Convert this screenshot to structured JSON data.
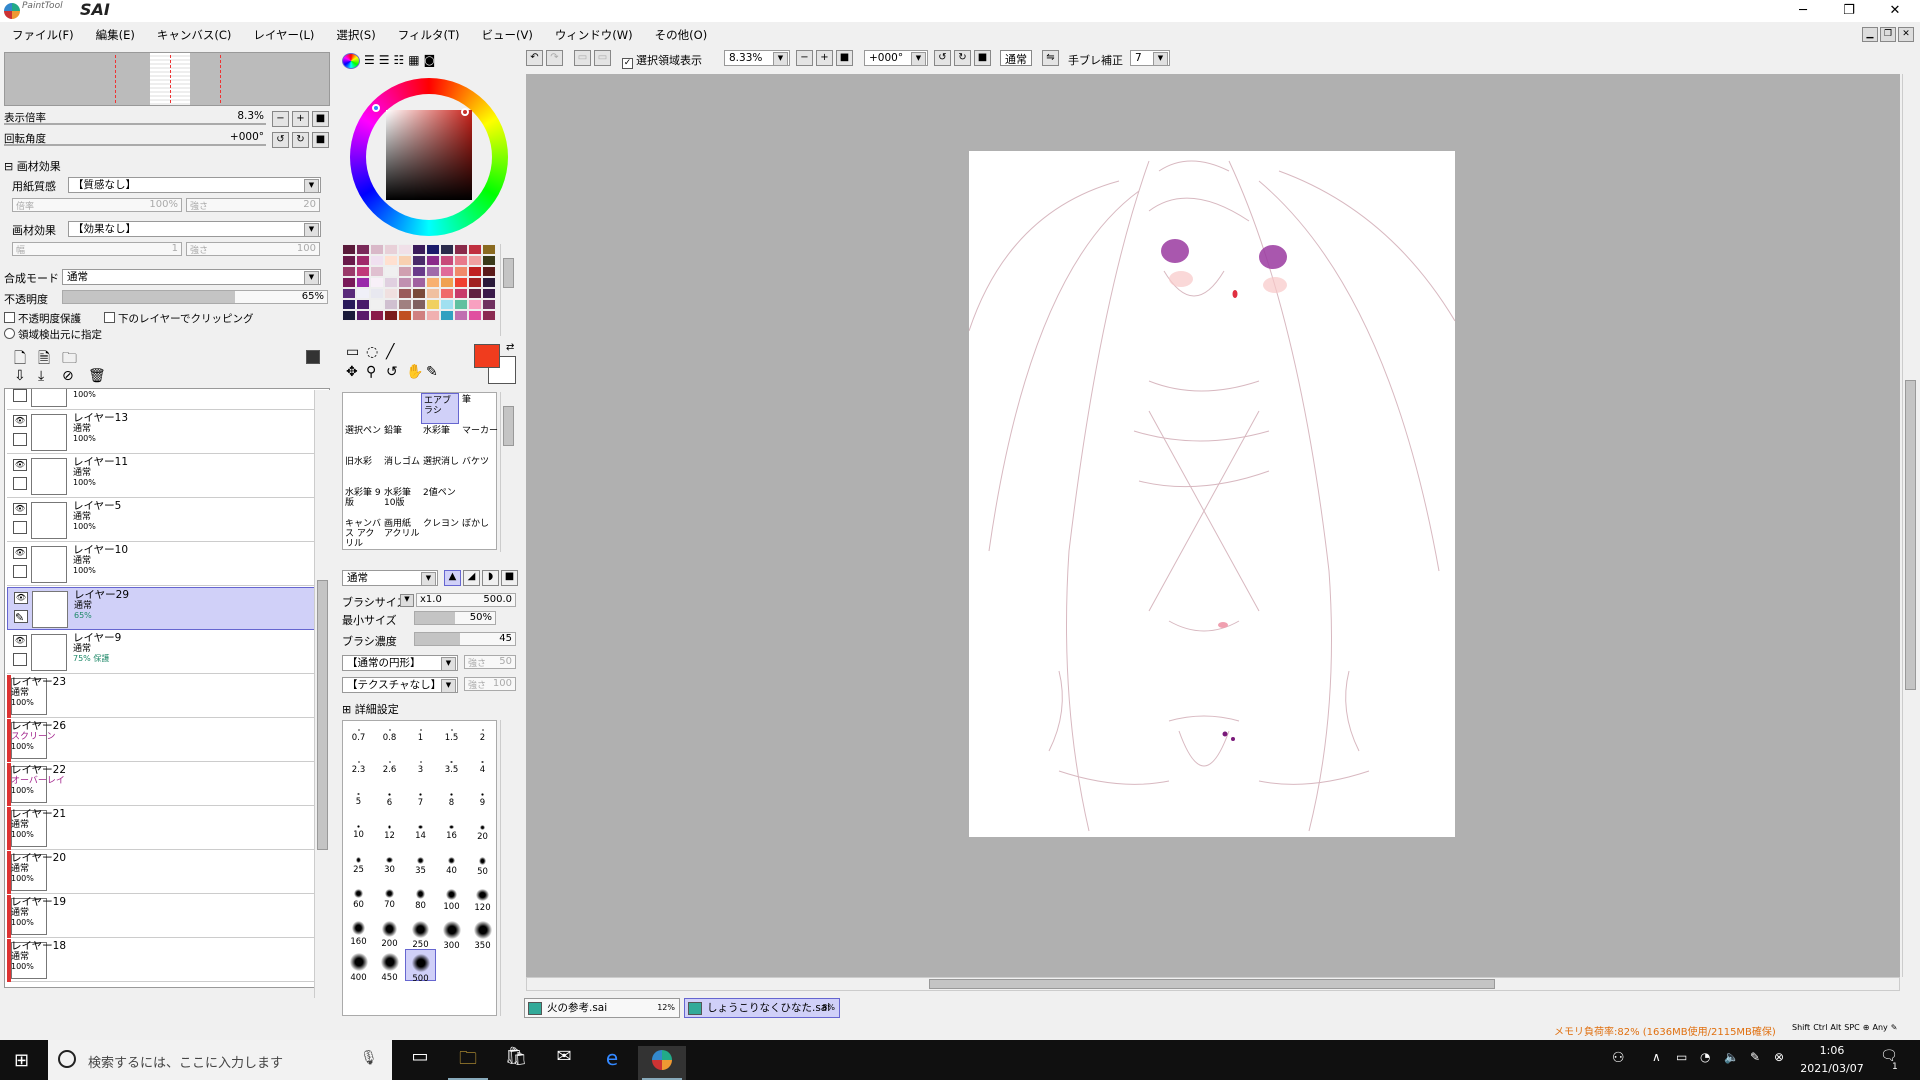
{
  "app": {
    "logo_small": "PaintTool",
    "logo_big": "SAI"
  },
  "window_controls": {
    "minimize": "─",
    "restore": "❐",
    "close": "✕"
  },
  "menu": [
    "ファイル(F)",
    "編集(E)",
    "キャンバス(C)",
    "レイヤー(L)",
    "選択(S)",
    "フィルタ(T)",
    "ビュー(V)",
    "ウィンドウ(W)",
    "その他(O)"
  ],
  "navigator": {
    "zoom_label": "表示倍率",
    "zoom_value": "8.3%",
    "rotation_label": "回転角度",
    "rotation_value": "+000°"
  },
  "material_effects": {
    "header": "画材効果",
    "paper_label": "用紙質感",
    "paper_value": "【質感なし】",
    "scale_label": "倍率",
    "scale_value": "100%",
    "strength_label": "強さ",
    "strength_value": "20",
    "effect_label": "画材効果",
    "effect_value": "【効果なし】",
    "width_label": "幅",
    "width_value": "1",
    "strength2_label": "強さ",
    "strength2_value": "100"
  },
  "layer_props": {
    "blend_label": "合成モード",
    "blend_value": "通常",
    "opacity_label": "不透明度",
    "opacity_value": "65%",
    "opacity_fraction": 0.65,
    "protect_label": "不透明度保護",
    "clip_label": "下のレイヤーでクリッピング",
    "selection_source_label": "領域検出元に指定"
  },
  "layers": [
    {
      "name": "",
      "mode": "通常",
      "opacity": "100%",
      "red": false,
      "selected": false
    },
    {
      "name": "レイヤー13",
      "mode": "通常",
      "opacity": "100%",
      "red": false,
      "selected": false
    },
    {
      "name": "レイヤー11",
      "mode": "通常",
      "opacity": "100%",
      "red": false,
      "selected": false
    },
    {
      "name": "レイヤー5",
      "mode": "通常",
      "opacity": "100%",
      "red": false,
      "selected": false
    },
    {
      "name": "レイヤー10",
      "mode": "通常",
      "opacity": "100%",
      "red": false,
      "selected": false
    },
    {
      "name": "レイヤー29",
      "mode": "通常",
      "opacity": "65%",
      "red": false,
      "selected": true
    },
    {
      "name": "レイヤー9",
      "mode": "通常",
      "opacity": "75%  保護",
      "red": false,
      "selected": false
    },
    {
      "name": "レイヤー23",
      "mode": "通常",
      "opacity": "100%",
      "red": true,
      "selected": false
    },
    {
      "name": "レイヤー26",
      "mode": "スクリーン",
      "opacity": "100%",
      "red": true,
      "selected": false
    },
    {
      "name": "レイヤー22",
      "mode": "オーバーレイ",
      "opacity": "100%",
      "red": true,
      "selected": false
    },
    {
      "name": "レイヤー21",
      "mode": "通常",
      "opacity": "100%",
      "red": true,
      "selected": false
    },
    {
      "name": "レイヤー20",
      "mode": "通常",
      "opacity": "100%",
      "red": true,
      "selected": false
    },
    {
      "name": "レイヤー19",
      "mode": "通常",
      "opacity": "100%",
      "red": true,
      "selected": false
    },
    {
      "name": "レイヤー18",
      "mode": "通常",
      "opacity": "100%",
      "red": true,
      "selected": false
    }
  ],
  "colors": {
    "primary": "#f03c1e",
    "secondary": "#ffffff",
    "accent_sel": "#d0d0f8"
  },
  "swatches": [
    "#5a1a3a",
    "#7a2a5a",
    "#d9b8c8",
    "#e8d0d8",
    "#f0e0e8",
    "#3a1a5a",
    "#1a1a6a",
    "#2a2a4a",
    "#8a2a4a",
    "#c03040",
    "#8a6a20",
    "#6a1a4a",
    "#a02a6a",
    "#f0e0f0",
    "#ffe0d0",
    "#f8d0b0",
    "#4a2a6a",
    "#8a2a8a",
    "#c84a7a",
    "#e87a8a",
    "#f0a0a0",
    "#3a3a1a",
    "#9a3a6a",
    "#c03a7a",
    "#e0c0d0",
    "#f0f0f0",
    "#d0a0b0",
    "#6a3a8a",
    "#a06aaa",
    "#e06a9a",
    "#f08a6a",
    "#c02020",
    "#5a1a1a",
    "#7a1a5a",
    "#9a2aaa",
    "#f8f0f8",
    "#e0d0e0",
    "#c090b0",
    "#a060a0",
    "#f8b070",
    "#f0a050",
    "#f04030",
    "#a02020",
    "#2a1a3a",
    "#5a2a7a",
    "#f0f0f8",
    "#e8e8f0",
    "#f0e0e0",
    "#9a5a5a",
    "#7a4a3a",
    "#f0c0a0",
    "#f06a6a",
    "#c83a6a",
    "#602040",
    "#3a1a4a",
    "#2a1a5a",
    "#4a1a6a",
    "#f0f0f0",
    "#d0c0d0",
    "#a08080",
    "#806060",
    "#f0d060",
    "#a0e0f0",
    "#60c0a0",
    "#f8a0c0",
    "#703060",
    "#1a1a3a",
    "#5a1a6a",
    "#8a1a4a",
    "#7a1a1a",
    "#c05020",
    "#d08080",
    "#f0b0b0",
    "#30a0c0",
    "#c070b0",
    "#e050a0",
    "#8a2a50"
  ],
  "tools": {
    "top_row": [
      "▭",
      "◌",
      "╱"
    ],
    "second_row": [
      "✥",
      "⚲",
      "↺",
      "✋",
      "✎"
    ]
  },
  "brush_presets": [
    [
      "エアブラシ",
      "筆"
    ],
    [
      "選択ペン",
      "鉛筆",
      "水彩筆",
      "マーカー"
    ],
    [
      "旧水彩",
      "消しゴム",
      "選択消し",
      "バケツ"
    ],
    [
      "水彩筆 9版",
      "水彩筆 10版",
      "2値ペン",
      ""
    ],
    [
      "キャンバス アクリル",
      "画用紙 アクリル",
      "クレヨン",
      "ぼかし"
    ]
  ],
  "brush_settings": {
    "mode_value": "通常",
    "size_label": "ブラシサイズ",
    "size_mult": "x1.0",
    "size_value": "500.0",
    "min_label": "最小サイズ",
    "min_value": "50%",
    "min_fraction": 0.5,
    "density_label": "ブラシ濃度",
    "density_value": "45",
    "density_fraction": 0.45,
    "shape_value": "【通常の円形】",
    "shape_str_label": "強さ",
    "shape_str_value": "50",
    "texture_value": "【テクスチャなし】",
    "tex_str_label": "強さ",
    "tex_str_value": "100",
    "detail_label": "詳細設定"
  },
  "brush_sizes": [
    "0.7",
    "0.8",
    "1",
    "1.5",
    "2",
    "2.3",
    "2.6",
    "3",
    "3.5",
    "4",
    "5",
    "6",
    "7",
    "8",
    "9",
    "10",
    "12",
    "14",
    "16",
    "20",
    "25",
    "30",
    "35",
    "40",
    "50",
    "60",
    "70",
    "80",
    "100",
    "120",
    "160",
    "200",
    "250",
    "300",
    "350",
    "400",
    "450",
    "500"
  ],
  "canvas_toolbar": {
    "selection_toggle_label": "選択領域表示",
    "zoom_value": "8.33%",
    "rotation_value": "+000°",
    "blend_label": "通常",
    "stabilizer_label": "手ブレ補正",
    "stabilizer_value": "7"
  },
  "doc_tabs": [
    {
      "name": "火の参考.sai",
      "pct": "12%",
      "active": false
    },
    {
      "name": "しょうこりなくひなた.sai",
      "pct": "8%",
      "active": true
    }
  ],
  "status": {
    "memory": "メモリ負荷率:82% (1636MB使用/2115MB確保)",
    "keys": [
      "Shift",
      "Ctrl",
      "Alt",
      "SPC",
      "Any"
    ]
  },
  "taskbar": {
    "search_placeholder": "検索するには、ここに入力します",
    "time": "1:06",
    "date": "2021/03/07",
    "notification_count": "1"
  }
}
